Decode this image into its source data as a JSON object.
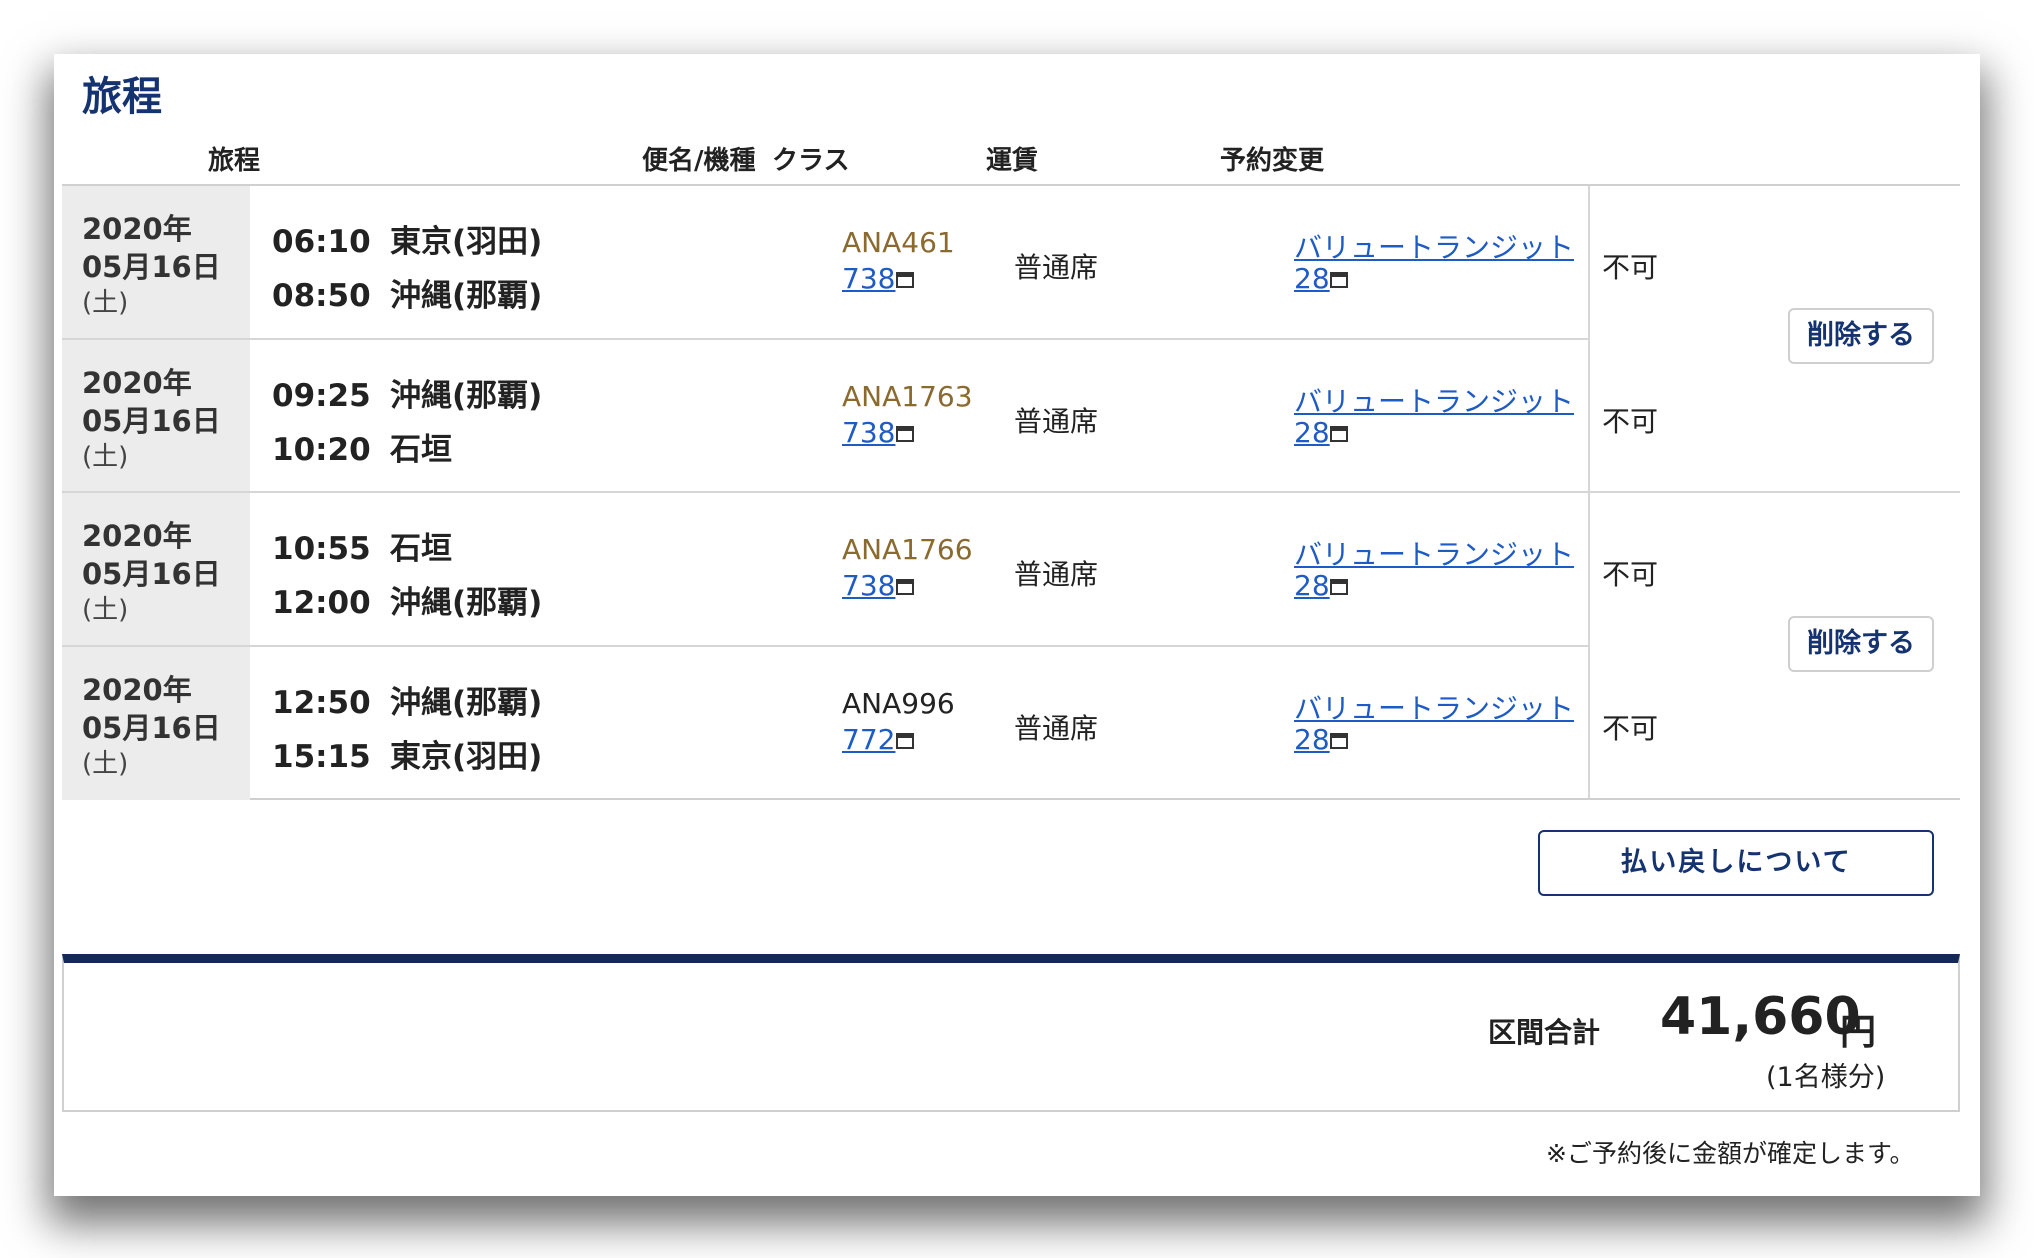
{
  "title": "旅程",
  "headers": {
    "itinerary": "旅程",
    "flight": "便名/機種",
    "class": "クラス",
    "fare": "運賃",
    "change": "予約変更"
  },
  "rows": [
    {
      "year": "2020年",
      "monthday": "05月16日",
      "weekday": "(土)",
      "dep_time": "06:10",
      "dep_place": "東京(羽田)",
      "arr_time": "08:50",
      "arr_place": "沖縄(那覇)",
      "flight": "ANA461",
      "equipment": "738",
      "class": "普通席",
      "fare": "バリュートランジット",
      "fare_code": "28",
      "change": "不可"
    },
    {
      "year": "2020年",
      "monthday": "05月16日",
      "weekday": "(土)",
      "dep_time": "09:25",
      "dep_place": "沖縄(那覇)",
      "arr_time": "10:20",
      "arr_place": "石垣",
      "flight": "ANA1763",
      "equipment": "738",
      "class": "普通席",
      "fare": "バリュートランジット",
      "fare_code": "28",
      "change": "不可"
    },
    {
      "year": "2020年",
      "monthday": "05月16日",
      "weekday": "(土)",
      "dep_time": "10:55",
      "dep_place": "石垣",
      "arr_time": "12:00",
      "arr_place": "沖縄(那覇)",
      "flight": "ANA1766",
      "equipment": "738",
      "class": "普通席",
      "fare": "バリュートランジット",
      "fare_code": "28",
      "change": "不可"
    },
    {
      "year": "2020年",
      "monthday": "05月16日",
      "weekday": "(土)",
      "dep_time": "12:50",
      "dep_place": "沖縄(那覇)",
      "arr_time": "15:15",
      "arr_place": "東京(羽田)",
      "flight": "ANA996",
      "equipment": "772",
      "class": "普通席",
      "fare": "バリュートランジット",
      "fare_code": "28",
      "change": "不可"
    }
  ],
  "delete_label": "削除する",
  "refund_label": "払い戻しについて",
  "total": {
    "label": "区間合計",
    "amount": "41,660",
    "currency": "円",
    "per": "(1名様分)"
  },
  "footnote": "※ご予約後に金額が確定します。",
  "colors": {
    "navy": "#143370",
    "link": "#1e5bc6",
    "flight_gold": "#8a6a2e"
  }
}
